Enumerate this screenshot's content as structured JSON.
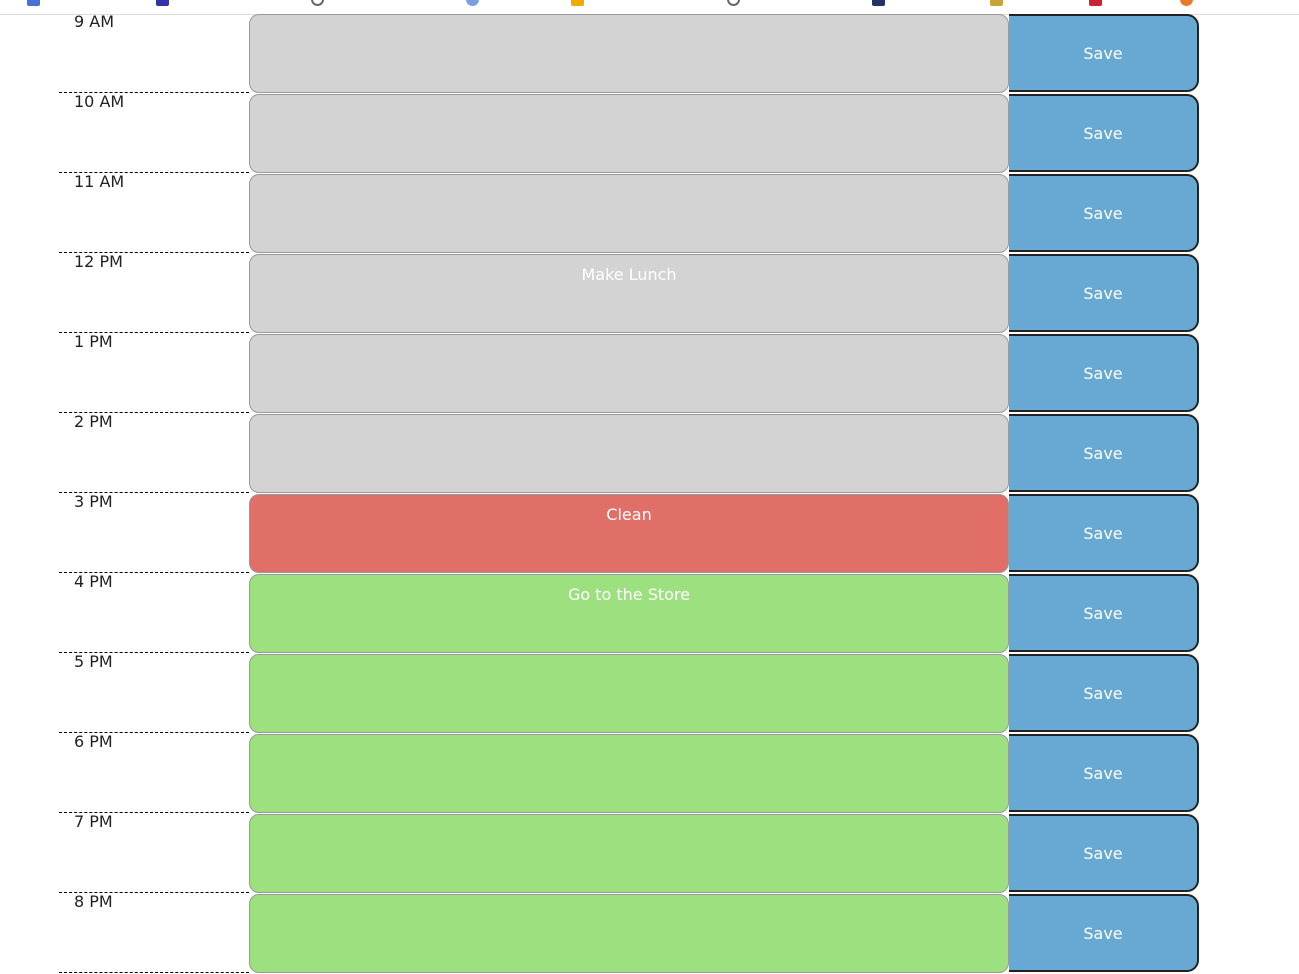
{
  "bookmarks_bar": {
    "icons": [
      {
        "name": "bookmark-1-icon",
        "color": "#4a6fd6",
        "shape": "square"
      },
      {
        "name": "bookmark-2-icon",
        "color": "#3333aa",
        "shape": "square"
      },
      {
        "name": "bookmark-3-icon",
        "color": "#666666",
        "shape": "ring"
      },
      {
        "name": "bookmark-4-icon",
        "color": "#7a9fe0",
        "shape": "circle"
      },
      {
        "name": "bookmark-5-icon",
        "color": "#f2a900",
        "shape": "square"
      },
      {
        "name": "bookmark-6-icon",
        "color": "#666666",
        "shape": "ring"
      },
      {
        "name": "bookmark-7-icon",
        "color": "#223366",
        "shape": "square"
      },
      {
        "name": "bookmark-8-icon",
        "color": "#c8a23a",
        "shape": "square"
      },
      {
        "name": "bookmark-9-icon",
        "color": "#cc2233",
        "shape": "square"
      },
      {
        "name": "bookmark-10-icon",
        "color": "#e8792a",
        "shape": "circle"
      }
    ]
  },
  "colors": {
    "past": "#d3d3d3",
    "present": "#e06f68",
    "future": "#9de07f",
    "save": "#67a9d2"
  },
  "time_blocks": [
    {
      "hour": "9 AM",
      "text": "",
      "state": "past",
      "save_label": "Save"
    },
    {
      "hour": "10 AM",
      "text": "",
      "state": "past",
      "save_label": "Save"
    },
    {
      "hour": "11 AM",
      "text": "",
      "state": "past",
      "save_label": "Save"
    },
    {
      "hour": "12 PM",
      "text": "Make Lunch",
      "state": "past",
      "save_label": "Save"
    },
    {
      "hour": "1 PM",
      "text": "",
      "state": "past",
      "save_label": "Save"
    },
    {
      "hour": "2 PM",
      "text": "",
      "state": "past",
      "save_label": "Save"
    },
    {
      "hour": "3 PM",
      "text": "Clean",
      "state": "present",
      "save_label": "Save"
    },
    {
      "hour": "4 PM",
      "text": "Go to the Store",
      "state": "future",
      "save_label": "Save"
    },
    {
      "hour": "5 PM",
      "text": "",
      "state": "future",
      "save_label": "Save"
    },
    {
      "hour": "6 PM",
      "text": "",
      "state": "future",
      "save_label": "Save"
    },
    {
      "hour": "7 PM",
      "text": "",
      "state": "future",
      "save_label": "Save"
    },
    {
      "hour": "8 PM",
      "text": "",
      "state": "future",
      "save_label": "Save"
    }
  ]
}
